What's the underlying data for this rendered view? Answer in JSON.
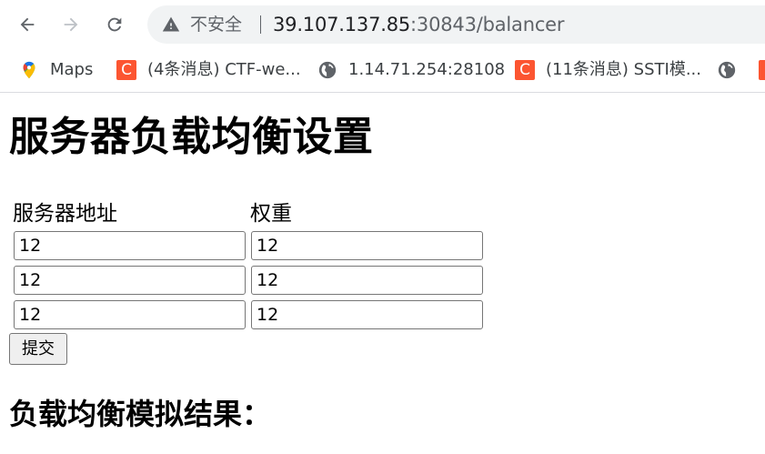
{
  "browser": {
    "security_label": "不安全",
    "url_host": "39.107.137.85",
    "url_rest": ":30843/balancer",
    "bookmarks": [
      {
        "label": "Maps",
        "icon": "google-maps-icon"
      },
      {
        "label": "(4条消息) CTF-we...",
        "icon": "csdn-icon"
      },
      {
        "label": "1.14.71.254:28108",
        "icon": "globe-icon"
      },
      {
        "label": "(11条消息) SSTI模...",
        "icon": "csdn-icon"
      },
      {
        "label": "",
        "icon": "globe-icon"
      }
    ],
    "csdn_letter": "C"
  },
  "page": {
    "title": "服务器负载均衡设置",
    "columns": {
      "address": "服务器地址",
      "weight": "权重"
    },
    "rows": [
      {
        "address": "12",
        "weight": "12"
      },
      {
        "address": "12",
        "weight": "12"
      },
      {
        "address": "12",
        "weight": "12"
      }
    ],
    "submit_label": "提交",
    "result_title": "负载均衡模拟结果："
  },
  "colors": {
    "csdn": "#fc5531",
    "omnibox_bg": "#f1f3f4",
    "muted_text": "#5f6368"
  }
}
